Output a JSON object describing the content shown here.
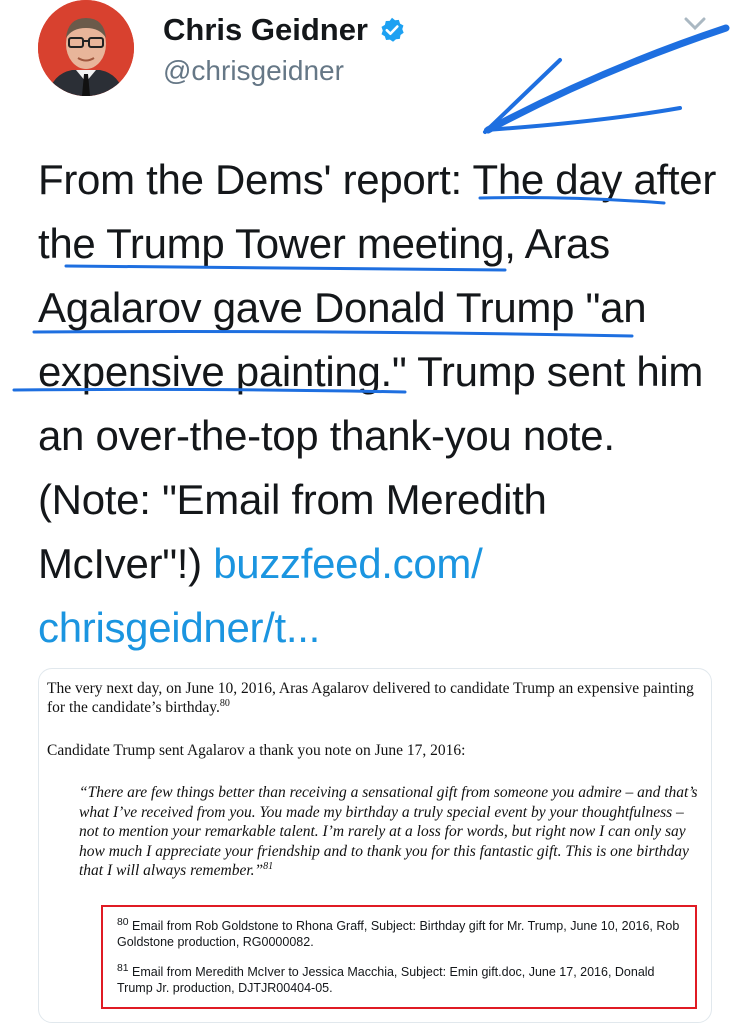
{
  "author": {
    "name": "Chris Geidner",
    "handle": "@chrisgeidner",
    "verified": true
  },
  "icons": {
    "verified": "verified-badge-icon",
    "menu": "chevron-down-icon"
  },
  "tweet": {
    "text_lines": [
      "From the Dems' report: The day after",
      "the Trump Tower meeting, Aras",
      "Agalarov gave Donald Trump \"an",
      "expensive painting.\" Trump sent him",
      "an over-the-top thank-you note.",
      "(Note: \"Email from Meredith",
      "McIver\"!) "
    ],
    "link_part1": "buzzfeed.com/",
    "link_part2": "chrisgeidner/t..."
  },
  "document": {
    "paragraph1": "The very next day, on June 10, 2016, Aras Agalarov delivered to candidate Trump an expensive painting for the candidate’s birthday.",
    "paragraph1_ref": "80",
    "paragraph2": "Candidate Trump sent Agalarov a thank you note on June 17, 2016:",
    "quote": "“There are few things better than receiving a sensational gift from someone you admire – and that’s what I’ve received from you. You made my birthday a truly special event by your thoughtfulness – not to mention your remarkable talent. I’m rarely at a loss for words, but right now I can only say how much I appreciate your friendship and to thank you for this fantastic gift. This is one birthday that I will always remember.”",
    "quote_ref": "81",
    "footnotes": [
      {
        "ref": "80",
        "text": " Email from Rob Goldstone to Rhona Graff, Subject: Birthday gift for Mr. Trump, June 10, 2016, Rob Goldstone production, RG0000082."
      },
      {
        "ref": "81",
        "text": " Email from Meredith McIver to Jessica Macchia, Subject: Emin gift.doc, June 17, 2016, Donald Trump Jr. production, DJTJR00404-05."
      }
    ]
  },
  "colors": {
    "link": "#1b95e0",
    "ink_annotation": "#1e6fe0",
    "footnote_border": "#e01b24",
    "verified": "#1da1f2"
  }
}
